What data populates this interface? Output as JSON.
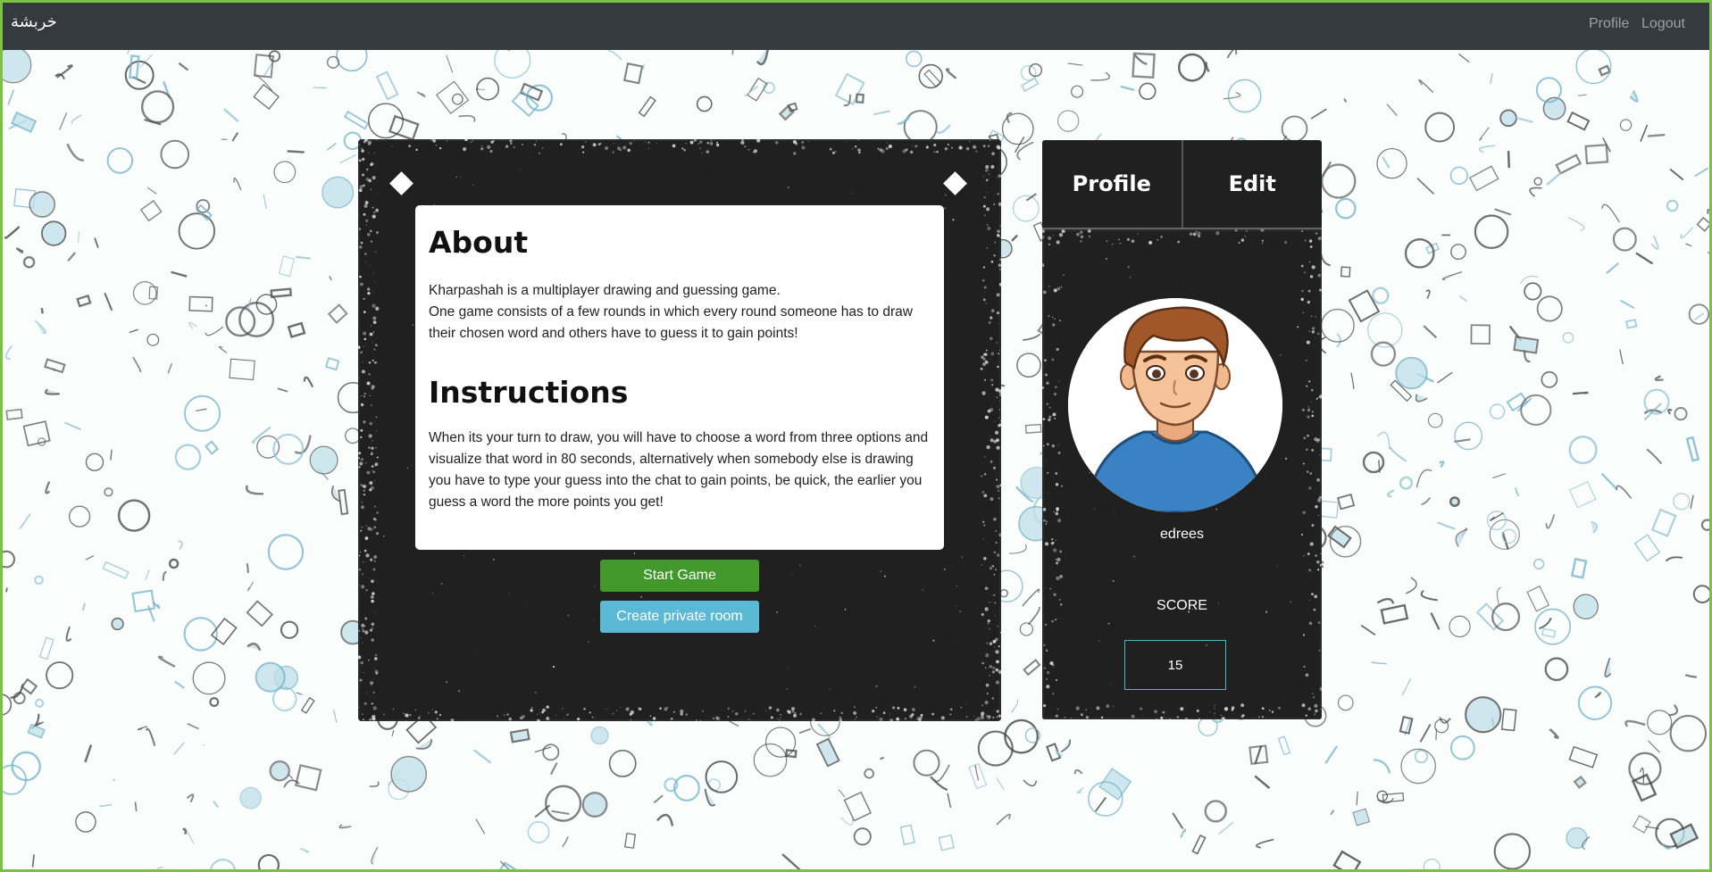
{
  "navbar": {
    "brand": "خربشة",
    "links": {
      "profile": "Profile",
      "logout": "Logout"
    }
  },
  "about": {
    "title": "About",
    "text_line1": "Kharpashah is a multiplayer drawing and guessing game.",
    "text_line2": "One game consists of a few rounds in which every round someone has to draw their chosen word and others have to guess it to gain points!"
  },
  "instructions": {
    "title": "Instructions",
    "text": "When its your turn to draw, you will have to choose a word from three options and visualize that word in 80 seconds, alternatively when somebody else is drawing you have to type your guess into the chat to gain points, be quick, the earlier you guess a word the more points you get!"
  },
  "buttons": {
    "start": "Start Game",
    "private": "Create private room"
  },
  "profile_panel": {
    "tabs": {
      "profile": "Profile",
      "edit": "Edit"
    },
    "username": "edrees",
    "score_label": "SCORE",
    "score_value": "15"
  },
  "colors": {
    "navbar": "#343a40",
    "panel": "#202020",
    "start_button": "#43982c",
    "private_button": "#5bb9d6",
    "frame": "#7cc242",
    "score_border": "#4bb8d0"
  }
}
